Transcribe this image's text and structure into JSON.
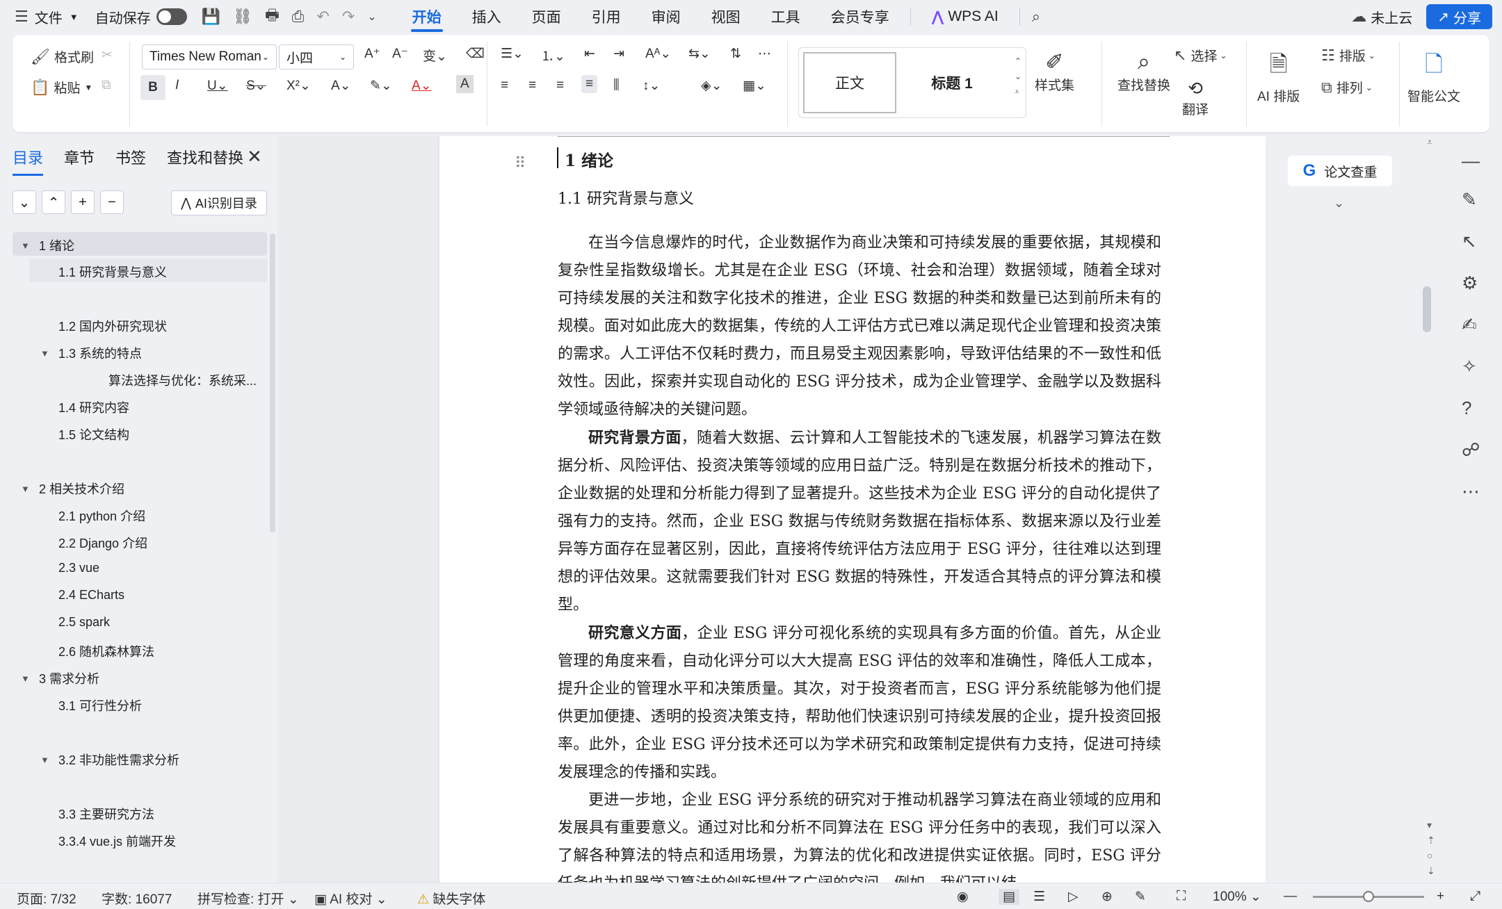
{
  "menubar": {
    "file_label": "文件",
    "autosave_label": "自动保存",
    "tabs": [
      "开始",
      "插入",
      "页面",
      "引用",
      "审阅",
      "视图",
      "工具",
      "会员专享"
    ],
    "wps_ai": "WPS AI",
    "cloud": "未上云",
    "share": "分享"
  },
  "ribbon": {
    "format_painter": "格式刷",
    "paste": "粘贴",
    "font": "Times New Roman",
    "size": "小四",
    "style_normal": "正文",
    "style_heading": "标题 1",
    "style_set": "样式集",
    "find_replace": "查找替换",
    "select": "选择",
    "translate": "翻译",
    "ai_layout": "AI 排版",
    "layout": "排版",
    "arrange": "排列",
    "smart_doc": "智能公文"
  },
  "nav": {
    "tabs": [
      "目录",
      "章节",
      "书签",
      "查找和替换"
    ],
    "ai_toc": "AI识别目录",
    "items": [
      {
        "label": "1  绪论"
      },
      {
        "label": "1.1 研究背景与意义"
      },
      {
        "label": "1.2 国内外研究现状"
      },
      {
        "label": "1.3 系统的特点"
      },
      {
        "label": "算法选择与优化：系统采..."
      },
      {
        "label": "1.4 研究内容"
      },
      {
        "label": "1.5 论文结构"
      },
      {
        "label": "2  相关技术介绍"
      },
      {
        "label": "2.1 python 介绍"
      },
      {
        "label": "2.2 Django  介绍"
      },
      {
        "label": "2.3 vue"
      },
      {
        "label": "2.4 ECharts"
      },
      {
        "label": "2.5 spark"
      },
      {
        "label": "2.6  随机森林算法"
      },
      {
        "label": "3  需求分析"
      },
      {
        "label": "3.1 可行性分析"
      },
      {
        "label": "3.2  非功能性需求分析"
      },
      {
        "label": "3.3 主要研究方法"
      },
      {
        "label": "3.3.4 vue.js 前端开发"
      }
    ]
  },
  "document": {
    "heading1": "1  绪论",
    "heading2": "1.1 研究背景与意义",
    "p1": "在当今信息爆炸的时代，企业数据作为商业决策和可持续发展的重要依据，其规模和复杂性呈指数级增长。尤其是在企业 ESG（环境、社会和治理）数据领域，随着全球对可持续发展的关注和数字化技术的推进，企业 ESG 数据的种类和数量已达到前所未有的规模。面对如此庞大的数据集，传统的人工评估方式已难以满足现代企业管理和投资决策的需求。人工评估不仅耗时费力，而且易受主观因素影响，导致评估结果的不一致性和低效性。因此，探索并实现自动化的 ESG 评分技术，成为企业管理学、金融学以及数据科学领域亟待解决的关键问题。",
    "p2_bold": "研究背景方面",
    "p2": "，随着大数据、云计算和人工智能技术的飞速发展，机器学习算法在数据分析、风险评估、投资决策等领域的应用日益广泛。特别是在数据分析技术的推动下，企业数据的处理和分析能力得到了显著提升。这些技术为企业 ESG 评分的自动化提供了强有力的支持。然而，企业 ESG 数据与传统财务数据在指标体系、数据来源以及行业差异等方面存在显著区别，因此，直接将传统评估方法应用于 ESG 评分，往往难以达到理想的评估效果。这就需要我们针对 ESG 数据的特殊性，开发适合其特点的评分算法和模型。",
    "p3_bold": "研究意义方面",
    "p3": "，企业 ESG 评分可视化系统的实现具有多方面的价值。首先，从企业管理的角度来看，自动化评分可以大大提高 ESG 评估的效率和准确性，降低人工成本，提升企业的管理水平和决策质量。其次，对于投资者而言，ESG 评分系统能够为他们提供更加便捷、透明的投资决策支持，帮助他们快速识别可持续发展的企业，提升投资回报率。此外，企业 ESG 评分技术还可以为学术研究和政策制定提供有力支持，促进可持续发展理念的传播和实践。",
    "p4": "更进一步地，企业 ESG 评分系统的研究对于推动机器学习算法在商业领域的应用和发展具有重要意义。通过对比和分析不同算法在 ESG 评分任务中的表现，我们可以深入了解各种算法的特点和适用场景，为算法的优化和改进提供实证依据。同时，ESG 评分任务也为机器学习算法的创新提供了广阔的空间。例如，我们可以结"
  },
  "right": {
    "paper_check": "论文查重"
  },
  "status": {
    "page": "页面: 7/32",
    "words": "字数: 16077",
    "spell": "拼写检查: 打开",
    "ai_proof": "AI 校对",
    "missing_font": "缺失字体",
    "zoom": "100%"
  },
  "colors": {
    "accent": "#1a6be0",
    "font_color_bar": "#e02020"
  }
}
